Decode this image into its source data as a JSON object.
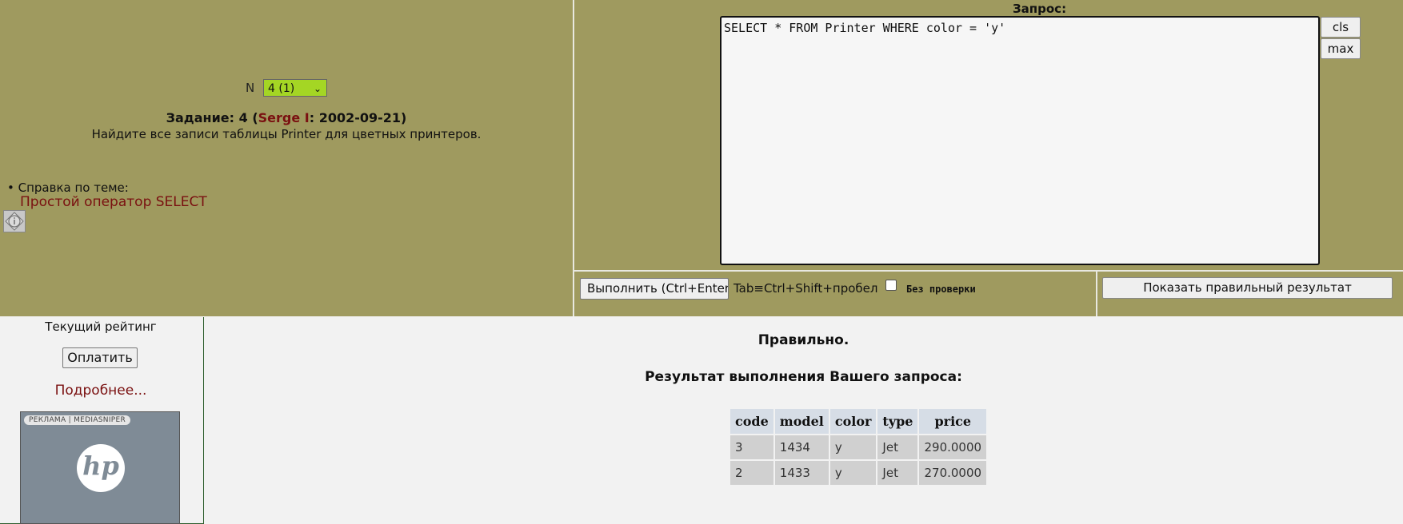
{
  "task_panel": {
    "n_label": "N",
    "n_selected": "4 (1)",
    "task_prefix": "Задание: 4 (",
    "task_author": "Serge I",
    "task_suffix": ": 2002-09-21)",
    "description": "Найдите все записи таблицы Printer для цветных принтеров.",
    "help_label": "• Справка по теме:",
    "help_link": "Простой оператор SELECT"
  },
  "query_panel": {
    "label": "Запрос:",
    "query_text": "SELECT * FROM Printer WHERE color = 'y'",
    "cls_label": "cls",
    "max_label": "max"
  },
  "controls": {
    "execute_label": "Выполнить (Ctrl+Enter)",
    "tab_hint": "Tab≡Ctrl+Shift+пробел",
    "nocheck_label": "Без проверки",
    "show_result_label": "Показать правильный результат"
  },
  "sidebar": {
    "rating_label": "Текущий рейтинг",
    "pay_label": "Оплатить",
    "more_link": "Подробнее...",
    "ad_tag": "РЕКЛАМА | MEDIASNIPER",
    "ad_logo_text": "hp"
  },
  "result": {
    "status": "Правильно.",
    "title": "Результат выполнения Вашего запроса:",
    "columns": [
      "code",
      "model",
      "color",
      "type",
      "price"
    ],
    "rows": [
      [
        "3",
        "1434",
        "y",
        "Jet",
        "290.0000"
      ],
      [
        "2",
        "1433",
        "y",
        "Jet",
        "270.0000"
      ]
    ]
  }
}
